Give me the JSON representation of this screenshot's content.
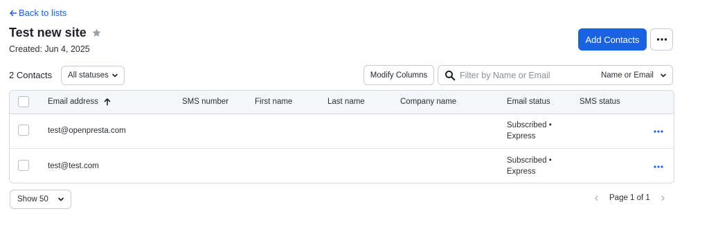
{
  "nav": {
    "back_label": "Back to lists"
  },
  "header": {
    "title": "Test new site",
    "created": "Created: Jun 4, 2025",
    "add_contacts_label": "Add Contacts"
  },
  "toolbar": {
    "count": "2 Contacts",
    "status_filter": "All statuses",
    "modify_columns_label": "Modify Columns",
    "search_placeholder": "Filter by Name or Email",
    "search_scope": "Name or Email"
  },
  "table": {
    "columns": [
      "Email address",
      "SMS number",
      "First name",
      "Last name",
      "Company name",
      "Email status",
      "SMS status"
    ],
    "sorted_column": "Email address",
    "sort_direction": "ascending",
    "rows": [
      {
        "email": "test@openpresta.com",
        "email_status_line1": "Subscribed •",
        "email_status_line2": "Express"
      },
      {
        "email": "test@test.com",
        "email_status_line1": "Subscribed •",
        "email_status_line2": "Express"
      }
    ]
  },
  "footer": {
    "page_size": "Show 50",
    "page_info": "Page 1 of 1"
  },
  "colors": {
    "accent": "#1a63e0",
    "link": "#1a5fd6",
    "star": "#9aa0a8"
  },
  "icons": [
    "arrow-left-icon",
    "star-icon",
    "more-horizontal-icon",
    "chevron-down-icon",
    "search-icon",
    "arrow-up-icon",
    "chevron-left-icon",
    "chevron-right-icon"
  ]
}
